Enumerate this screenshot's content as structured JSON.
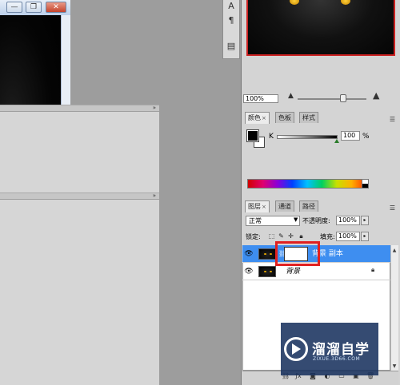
{
  "document_window": {
    "minimize_label": "—",
    "restore_label": "❐",
    "close_label": "✕"
  },
  "tool_strip": {
    "items": [
      {
        "icon": "character-icon",
        "glyph": "A"
      },
      {
        "icon": "paragraph-icon",
        "glyph": "¶"
      },
      {
        "icon": "tool-presets-icon",
        "glyph": "▤"
      }
    ]
  },
  "navigator": {
    "zoom": "100%",
    "zoom_out_icon": "mountain-small-icon",
    "zoom_in_icon": "mountain-large-icon"
  },
  "color_panel": {
    "tabs": [
      {
        "label": "颜色",
        "active": true
      },
      {
        "label": "色板",
        "active": false
      },
      {
        "label": "样式",
        "active": false
      }
    ],
    "channel_label": "K",
    "channel_value": "100",
    "channel_unit": "%",
    "foreground": "#000000",
    "background": "#ffffff"
  },
  "layers_panel": {
    "tabs": [
      {
        "label": "图层",
        "active": true
      },
      {
        "label": "通道",
        "active": false
      },
      {
        "label": "路径",
        "active": false
      }
    ],
    "blend_mode": "正常",
    "opacity_label": "不透明度:",
    "opacity_value": "100%",
    "lock_label": "锁定:",
    "fill_label": "填充:",
    "fill_value": "100%",
    "layers": [
      {
        "name": "背景 副本",
        "active": true,
        "visible": true,
        "has_mask": true,
        "locked": false
      },
      {
        "name": "背景",
        "active": false,
        "visible": true,
        "has_mask": false,
        "locked": true
      }
    ],
    "highlight_color": "#e02020",
    "selection_color": "#3e8ef0"
  },
  "watermark": {
    "title": "溜溜自学",
    "subtitle": "ZIXUE.3D66.COM"
  }
}
